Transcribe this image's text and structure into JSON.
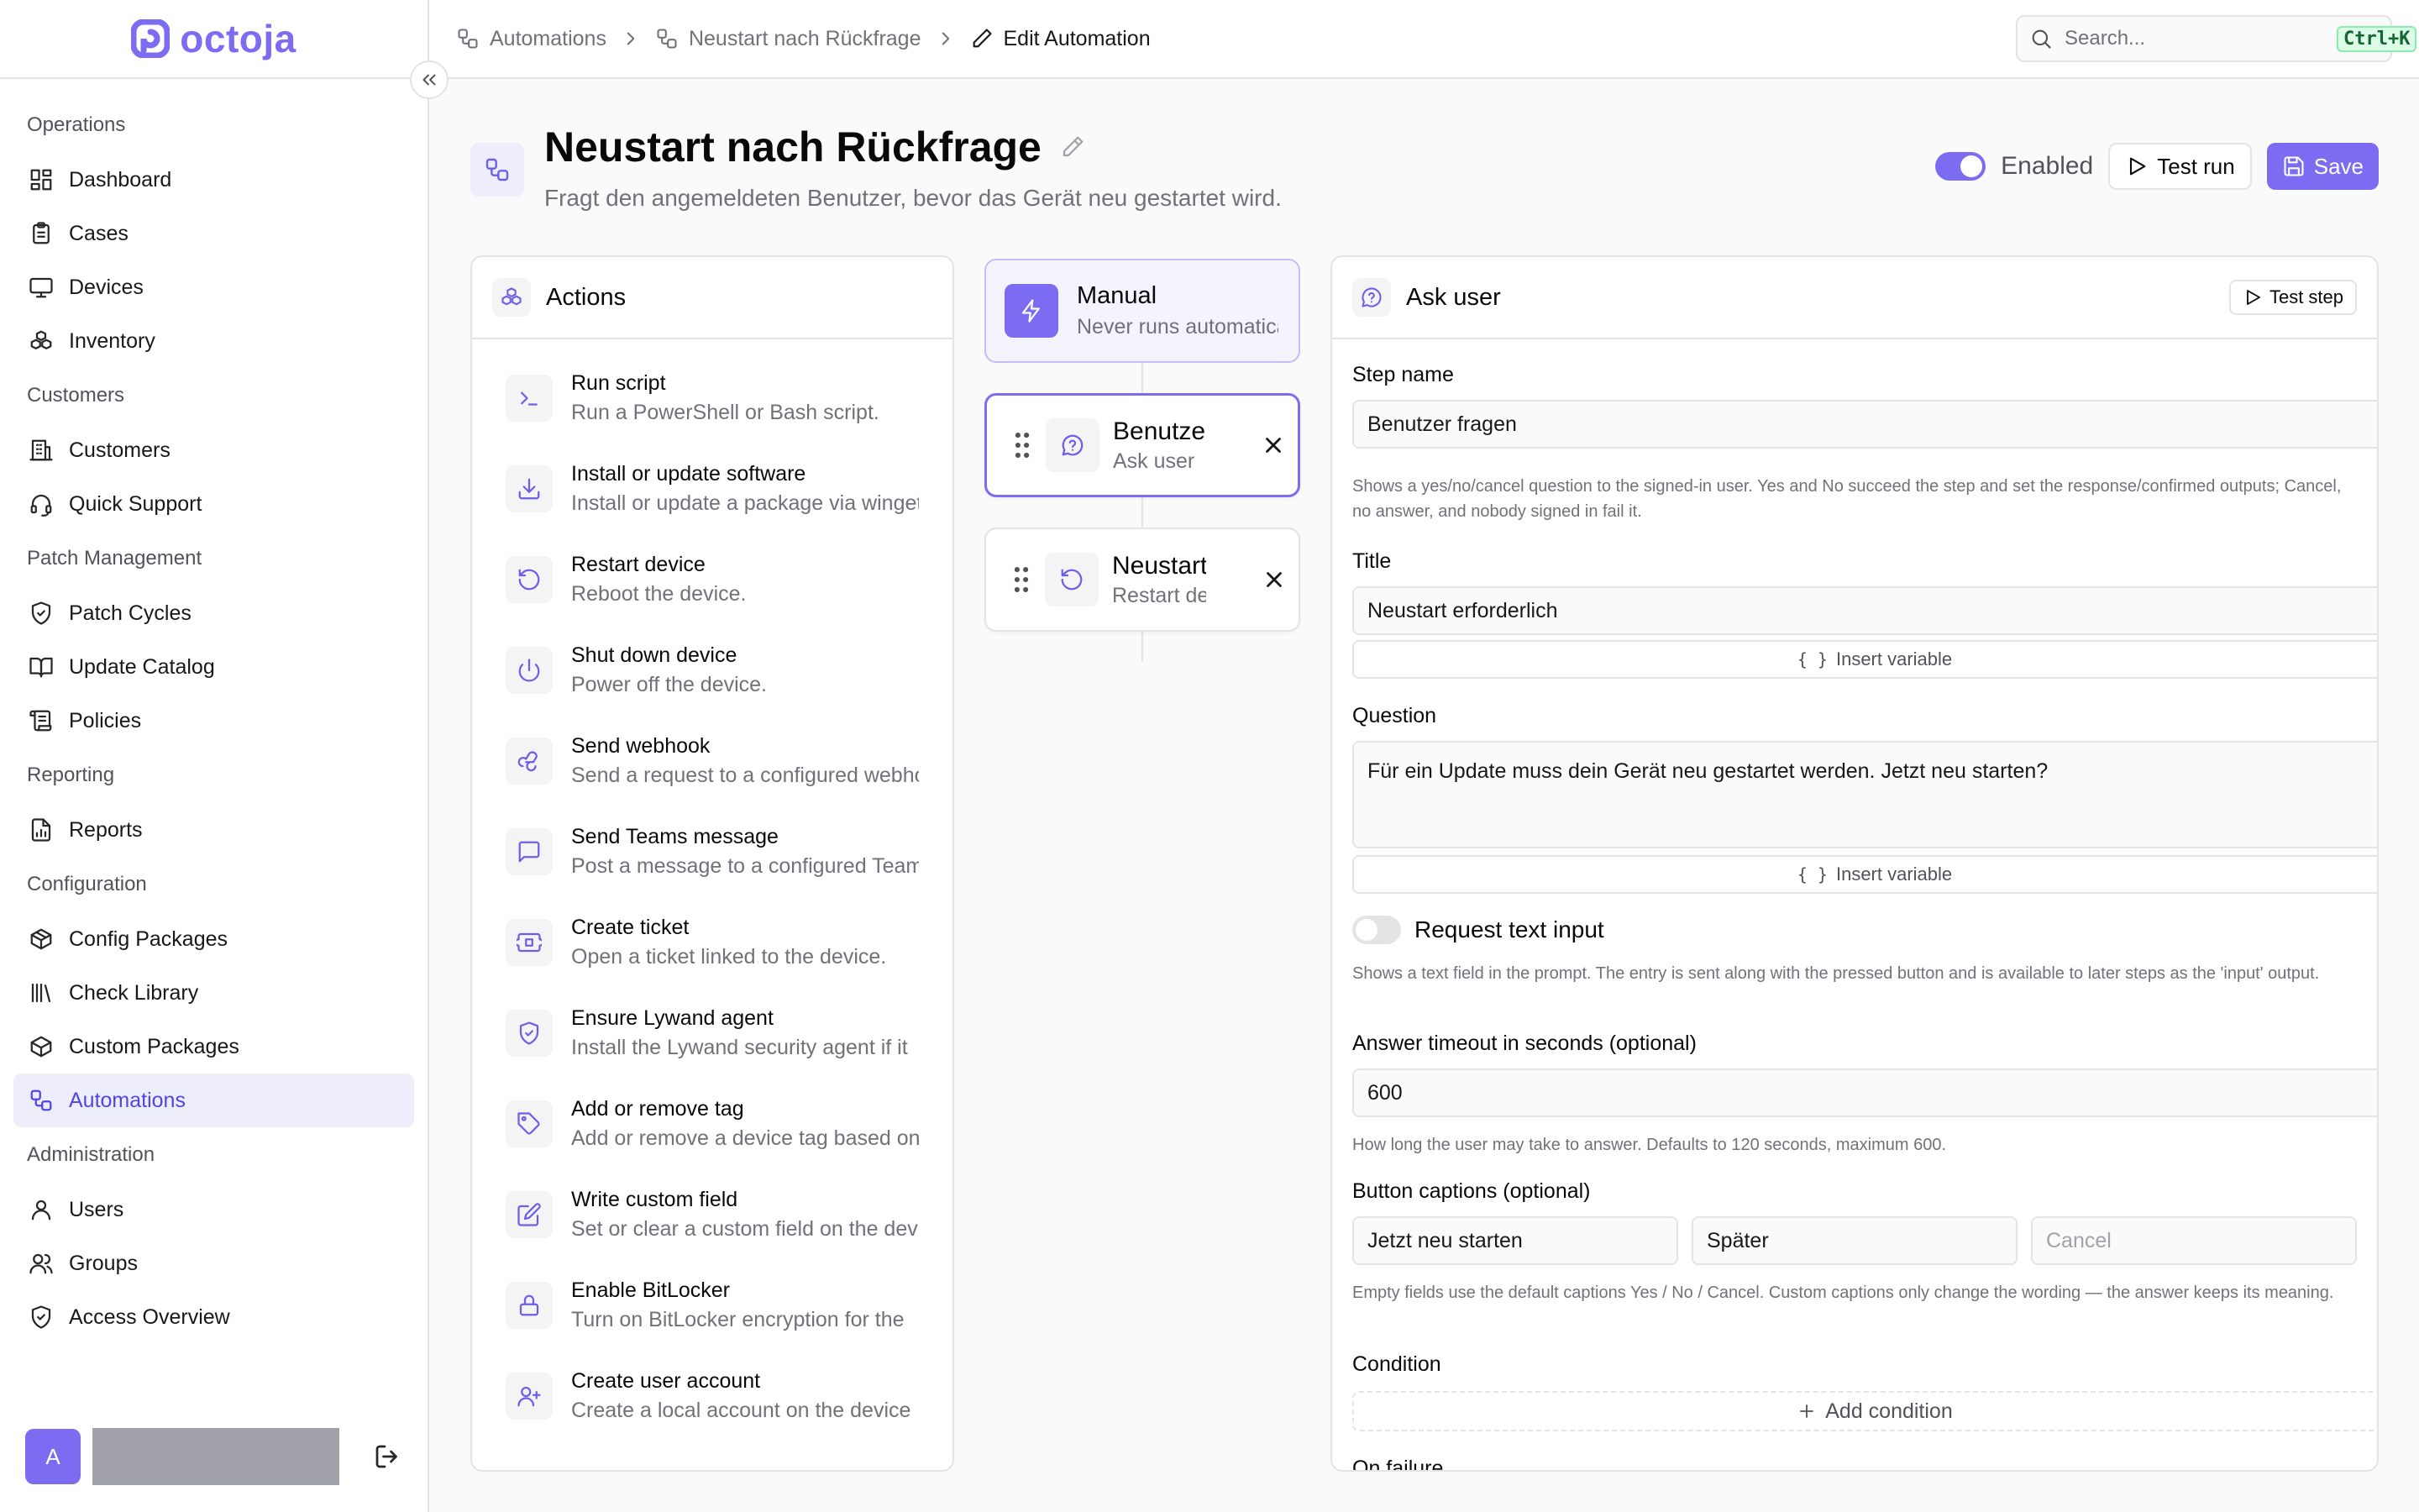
{
  "app": {
    "logo_text": "octoja"
  },
  "sidebar": {
    "groups": [
      {
        "label": "Operations",
        "items": [
          {
            "label": "Dashboard",
            "icon": "dashboard-icon"
          },
          {
            "label": "Cases",
            "icon": "clipboard-icon"
          },
          {
            "label": "Devices",
            "icon": "monitor-icon"
          },
          {
            "label": "Inventory",
            "icon": "boxes-icon"
          }
        ]
      },
      {
        "label": "Customers",
        "items": [
          {
            "label": "Customers",
            "icon": "building-icon"
          },
          {
            "label": "Quick Support",
            "icon": "headset-icon"
          }
        ]
      },
      {
        "label": "Patch Management",
        "items": [
          {
            "label": "Patch Cycles",
            "icon": "shield-check-icon"
          },
          {
            "label": "Update Catalog",
            "icon": "book-icon"
          },
          {
            "label": "Policies",
            "icon": "scroll-icon"
          }
        ]
      },
      {
        "label": "Reporting",
        "items": [
          {
            "label": "Reports",
            "icon": "report-icon"
          }
        ]
      },
      {
        "label": "Configuration",
        "items": [
          {
            "label": "Config Packages",
            "icon": "package-icon"
          },
          {
            "label": "Check Library",
            "icon": "library-icon"
          },
          {
            "label": "Custom Packages",
            "icon": "package-plus-icon"
          },
          {
            "label": "Automations",
            "icon": "workflow-icon",
            "active": true
          }
        ]
      },
      {
        "label": "Administration",
        "items": [
          {
            "label": "Users",
            "icon": "user-icon"
          },
          {
            "label": "Groups",
            "icon": "users-icon"
          },
          {
            "label": "Access Overview",
            "icon": "shield-icon"
          }
        ]
      }
    ],
    "user_initial": "A"
  },
  "breadcrumb": {
    "items": [
      "Automations",
      "Neustart nach Rückfrage"
    ],
    "current": "Edit Automation"
  },
  "search": {
    "placeholder": "Search...",
    "shortcut": "Ctrl+K"
  },
  "header": {
    "title": "Neustart nach Rückfrage",
    "subtitle": "Fragt den angemeldeten Benutzer, bevor das Gerät neu gestartet wird.",
    "enabled_label": "Enabled",
    "enabled": true,
    "test_run_label": "Test run",
    "save_label": "Save"
  },
  "actions_panel": {
    "title": "Actions",
    "items": [
      {
        "name": "Run script",
        "desc": "Run a PowerShell or Bash script.",
        "icon": "terminal-icon"
      },
      {
        "name": "Install or update software",
        "desc": "Install or update a package via winget",
        "icon": "download-icon"
      },
      {
        "name": "Restart device",
        "desc": "Reboot the device.",
        "icon": "restart-icon"
      },
      {
        "name": "Shut down device",
        "desc": "Power off the device.",
        "icon": "power-icon"
      },
      {
        "name": "Send webhook",
        "desc": "Send a request to a configured webhook",
        "icon": "webhook-icon"
      },
      {
        "name": "Send Teams message",
        "desc": "Post a message to a configured Teams",
        "icon": "message-icon"
      },
      {
        "name": "Create ticket",
        "desc": "Open a ticket linked to the device.",
        "icon": "ticket-icon"
      },
      {
        "name": "Ensure Lywand agent",
        "desc": "Install the Lywand security agent if it",
        "icon": "shield-check-icon"
      },
      {
        "name": "Add or remove tag",
        "desc": "Add or remove a device tag based on",
        "icon": "tag-icon"
      },
      {
        "name": "Write custom field",
        "desc": "Set or clear a custom field on the device",
        "icon": "edit-icon"
      },
      {
        "name": "Enable BitLocker",
        "desc": "Turn on BitLocker encryption for the",
        "icon": "lock-icon"
      },
      {
        "name": "Create user account",
        "desc": "Create a local account on the device",
        "icon": "user-plus-icon"
      }
    ]
  },
  "flow": {
    "trigger": {
      "title": "Manual",
      "subtitle": "Never runs automatically"
    },
    "steps": [
      {
        "title": "Benutzer fragen",
        "subtitle": "Ask user",
        "icon": "ask-user-icon",
        "selected": true
      },
      {
        "title": "Neustart",
        "subtitle": "Restart device",
        "icon": "restart-icon",
        "selected": false
      }
    ]
  },
  "detail": {
    "title": "Ask user",
    "test_step_label": "Test step",
    "step_name_label": "Step name",
    "step_name_value": "Benutzer fragen",
    "step_help": "Shows a yes/no/cancel question to the signed-in user. Yes and No succeed the step and set the response/confirmed outputs; Cancel, no answer, and nobody signed in fail it.",
    "title_label": "Title",
    "title_value": "Neustart erforderlich",
    "insert_variable_label": "Insert variable",
    "question_label": "Question",
    "question_value": "Für ein Update muss dein Gerät neu gestartet werden. Jetzt neu starten?",
    "request_text_input_label": "Request text input",
    "request_text_input": false,
    "text_input_help": "Shows a text field in the prompt. The entry is sent along with the pressed button and is available to later steps as the 'input' output.",
    "timeout_label": "Answer timeout in seconds (optional)",
    "timeout_value": "600",
    "timeout_help": "How long the user may take to answer. Defaults to 120 seconds, maximum 600.",
    "captions_label": "Button captions (optional)",
    "caption_yes": "Jetzt neu starten",
    "caption_no": "Später",
    "caption_cancel_placeholder": "Cancel",
    "captions_help": "Empty fields use the default captions Yes / No / Cancel. Custom captions only change the wording — the answer keeps its meaning.",
    "condition_label": "Condition",
    "add_condition_label": "Add condition",
    "on_failure_label": "On failure"
  },
  "colors": {
    "accent": "#7c6cf2",
    "active_bg": "#eeedfb",
    "border": "#e4e4e7"
  }
}
